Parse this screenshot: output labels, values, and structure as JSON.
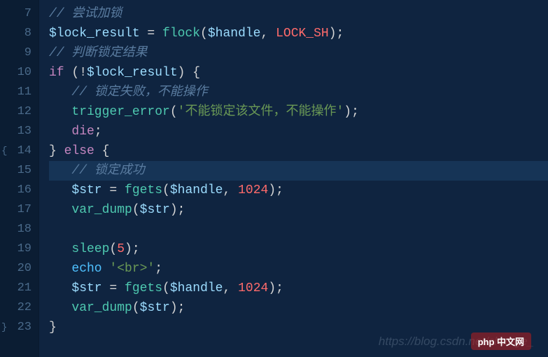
{
  "editor": {
    "highlighted_line": 15,
    "lines": [
      {
        "num": 7,
        "indent": 0,
        "fold": "",
        "segments": [
          {
            "cls": "comment",
            "key": "c1"
          }
        ]
      },
      {
        "num": 8,
        "indent": 0,
        "fold": "",
        "segments": [
          {
            "cls": "variable",
            "key": "v_lock_result"
          },
          {
            "cls": "operator",
            "text": " = "
          },
          {
            "cls": "function",
            "key": "fn_flock"
          },
          {
            "cls": "paren",
            "text": "("
          },
          {
            "cls": "variable",
            "key": "v_handle"
          },
          {
            "cls": "punct",
            "text": ", "
          },
          {
            "cls": "constant",
            "key": "const_locksh"
          },
          {
            "cls": "paren",
            "text": ")"
          },
          {
            "cls": "punct",
            "text": ";"
          }
        ]
      },
      {
        "num": 9,
        "indent": 0,
        "fold": "",
        "segments": [
          {
            "cls": "comment",
            "key": "c2"
          }
        ]
      },
      {
        "num": 10,
        "indent": 0,
        "fold": "",
        "segments": [
          {
            "cls": "keyword",
            "key": "kw_if"
          },
          {
            "cls": "paren",
            "text": " ("
          },
          {
            "cls": "operator",
            "text": "!"
          },
          {
            "cls": "variable",
            "key": "v_lock_result"
          },
          {
            "cls": "paren",
            "text": ") "
          },
          {
            "cls": "brace",
            "text": "{"
          }
        ]
      },
      {
        "num": 11,
        "indent": 1,
        "fold": "",
        "segments": [
          {
            "cls": "comment",
            "key": "c3"
          }
        ]
      },
      {
        "num": 12,
        "indent": 1,
        "fold": "",
        "segments": [
          {
            "cls": "function",
            "key": "fn_trigger"
          },
          {
            "cls": "paren",
            "text": "("
          },
          {
            "cls": "string",
            "key": "s_err"
          },
          {
            "cls": "paren",
            "text": ")"
          },
          {
            "cls": "punct",
            "text": ";"
          }
        ]
      },
      {
        "num": 13,
        "indent": 1,
        "fold": "",
        "segments": [
          {
            "cls": "keyword",
            "key": "kw_die"
          },
          {
            "cls": "punct",
            "text": ";"
          }
        ]
      },
      {
        "num": 14,
        "indent": 0,
        "fold": "open",
        "segments": [
          {
            "cls": "brace",
            "text": "} "
          },
          {
            "cls": "keyword",
            "key": "kw_else"
          },
          {
            "cls": "brace",
            "text": " {"
          }
        ]
      },
      {
        "num": 15,
        "indent": 1,
        "fold": "",
        "segments": [
          {
            "cls": "comment",
            "key": "c4"
          }
        ]
      },
      {
        "num": 16,
        "indent": 1,
        "fold": "",
        "segments": [
          {
            "cls": "variable",
            "key": "v_str"
          },
          {
            "cls": "operator",
            "text": " = "
          },
          {
            "cls": "function",
            "key": "fn_fgets"
          },
          {
            "cls": "paren",
            "text": "("
          },
          {
            "cls": "variable",
            "key": "v_handle"
          },
          {
            "cls": "punct",
            "text": ", "
          },
          {
            "cls": "number",
            "key": "n_1024"
          },
          {
            "cls": "paren",
            "text": ")"
          },
          {
            "cls": "punct",
            "text": ";"
          }
        ]
      },
      {
        "num": 17,
        "indent": 1,
        "fold": "",
        "segments": [
          {
            "cls": "function",
            "key": "fn_vardump"
          },
          {
            "cls": "paren",
            "text": "("
          },
          {
            "cls": "variable",
            "key": "v_str"
          },
          {
            "cls": "paren",
            "text": ")"
          },
          {
            "cls": "punct",
            "text": ";"
          }
        ]
      },
      {
        "num": 18,
        "indent": 1,
        "fold": "",
        "segments": []
      },
      {
        "num": 19,
        "indent": 1,
        "fold": "",
        "segments": [
          {
            "cls": "function",
            "key": "fn_sleep"
          },
          {
            "cls": "paren",
            "text": "("
          },
          {
            "cls": "number",
            "key": "n_5"
          },
          {
            "cls": "paren",
            "text": ")"
          },
          {
            "cls": "punct",
            "text": ";"
          }
        ]
      },
      {
        "num": 20,
        "indent": 1,
        "fold": "",
        "segments": [
          {
            "cls": "blue",
            "key": "kw_echo"
          },
          {
            "cls": "string",
            "key": "s_br"
          },
          {
            "cls": "punct",
            "text": ";"
          }
        ]
      },
      {
        "num": 21,
        "indent": 1,
        "fold": "",
        "segments": [
          {
            "cls": "variable",
            "key": "v_str"
          },
          {
            "cls": "operator",
            "text": " = "
          },
          {
            "cls": "function",
            "key": "fn_fgets"
          },
          {
            "cls": "paren",
            "text": "("
          },
          {
            "cls": "variable",
            "key": "v_handle"
          },
          {
            "cls": "punct",
            "text": ", "
          },
          {
            "cls": "number",
            "key": "n_1024"
          },
          {
            "cls": "paren",
            "text": ")"
          },
          {
            "cls": "punct",
            "text": ";"
          }
        ]
      },
      {
        "num": 22,
        "indent": 1,
        "fold": "",
        "segments": [
          {
            "cls": "function",
            "key": "fn_vardump"
          },
          {
            "cls": "paren",
            "text": "("
          },
          {
            "cls": "variable",
            "key": "v_str"
          },
          {
            "cls": "paren",
            "text": ")"
          },
          {
            "cls": "punct",
            "text": ";"
          }
        ]
      },
      {
        "num": 23,
        "indent": 0,
        "fold": "close",
        "segments": [
          {
            "cls": "brace",
            "text": "}"
          }
        ]
      }
    ]
  },
  "tokens": {
    "c1": "// 尝试加锁",
    "c2": "// 判断锁定结果",
    "c3": "// 锁定失败，不能操作",
    "c4": "// 锁定成功",
    "v_lock_result": "$lock_result",
    "v_handle": "$handle",
    "v_str": "$str",
    "fn_flock": "flock",
    "fn_trigger": "trigger_error",
    "fn_fgets": "fgets",
    "fn_vardump": "var_dump",
    "fn_sleep": "sleep",
    "const_locksh": "LOCK_SH",
    "kw_if": "if",
    "kw_die": "die",
    "kw_else": "else",
    "kw_echo": "echo ",
    "s_err": "'不能锁定该文件，不能操作'",
    "s_br": "'<br>'",
    "n_1024": "1024",
    "n_5": "5"
  },
  "watermark": "https://blog.csdn.net/change_",
  "logo": "php 中文网"
}
